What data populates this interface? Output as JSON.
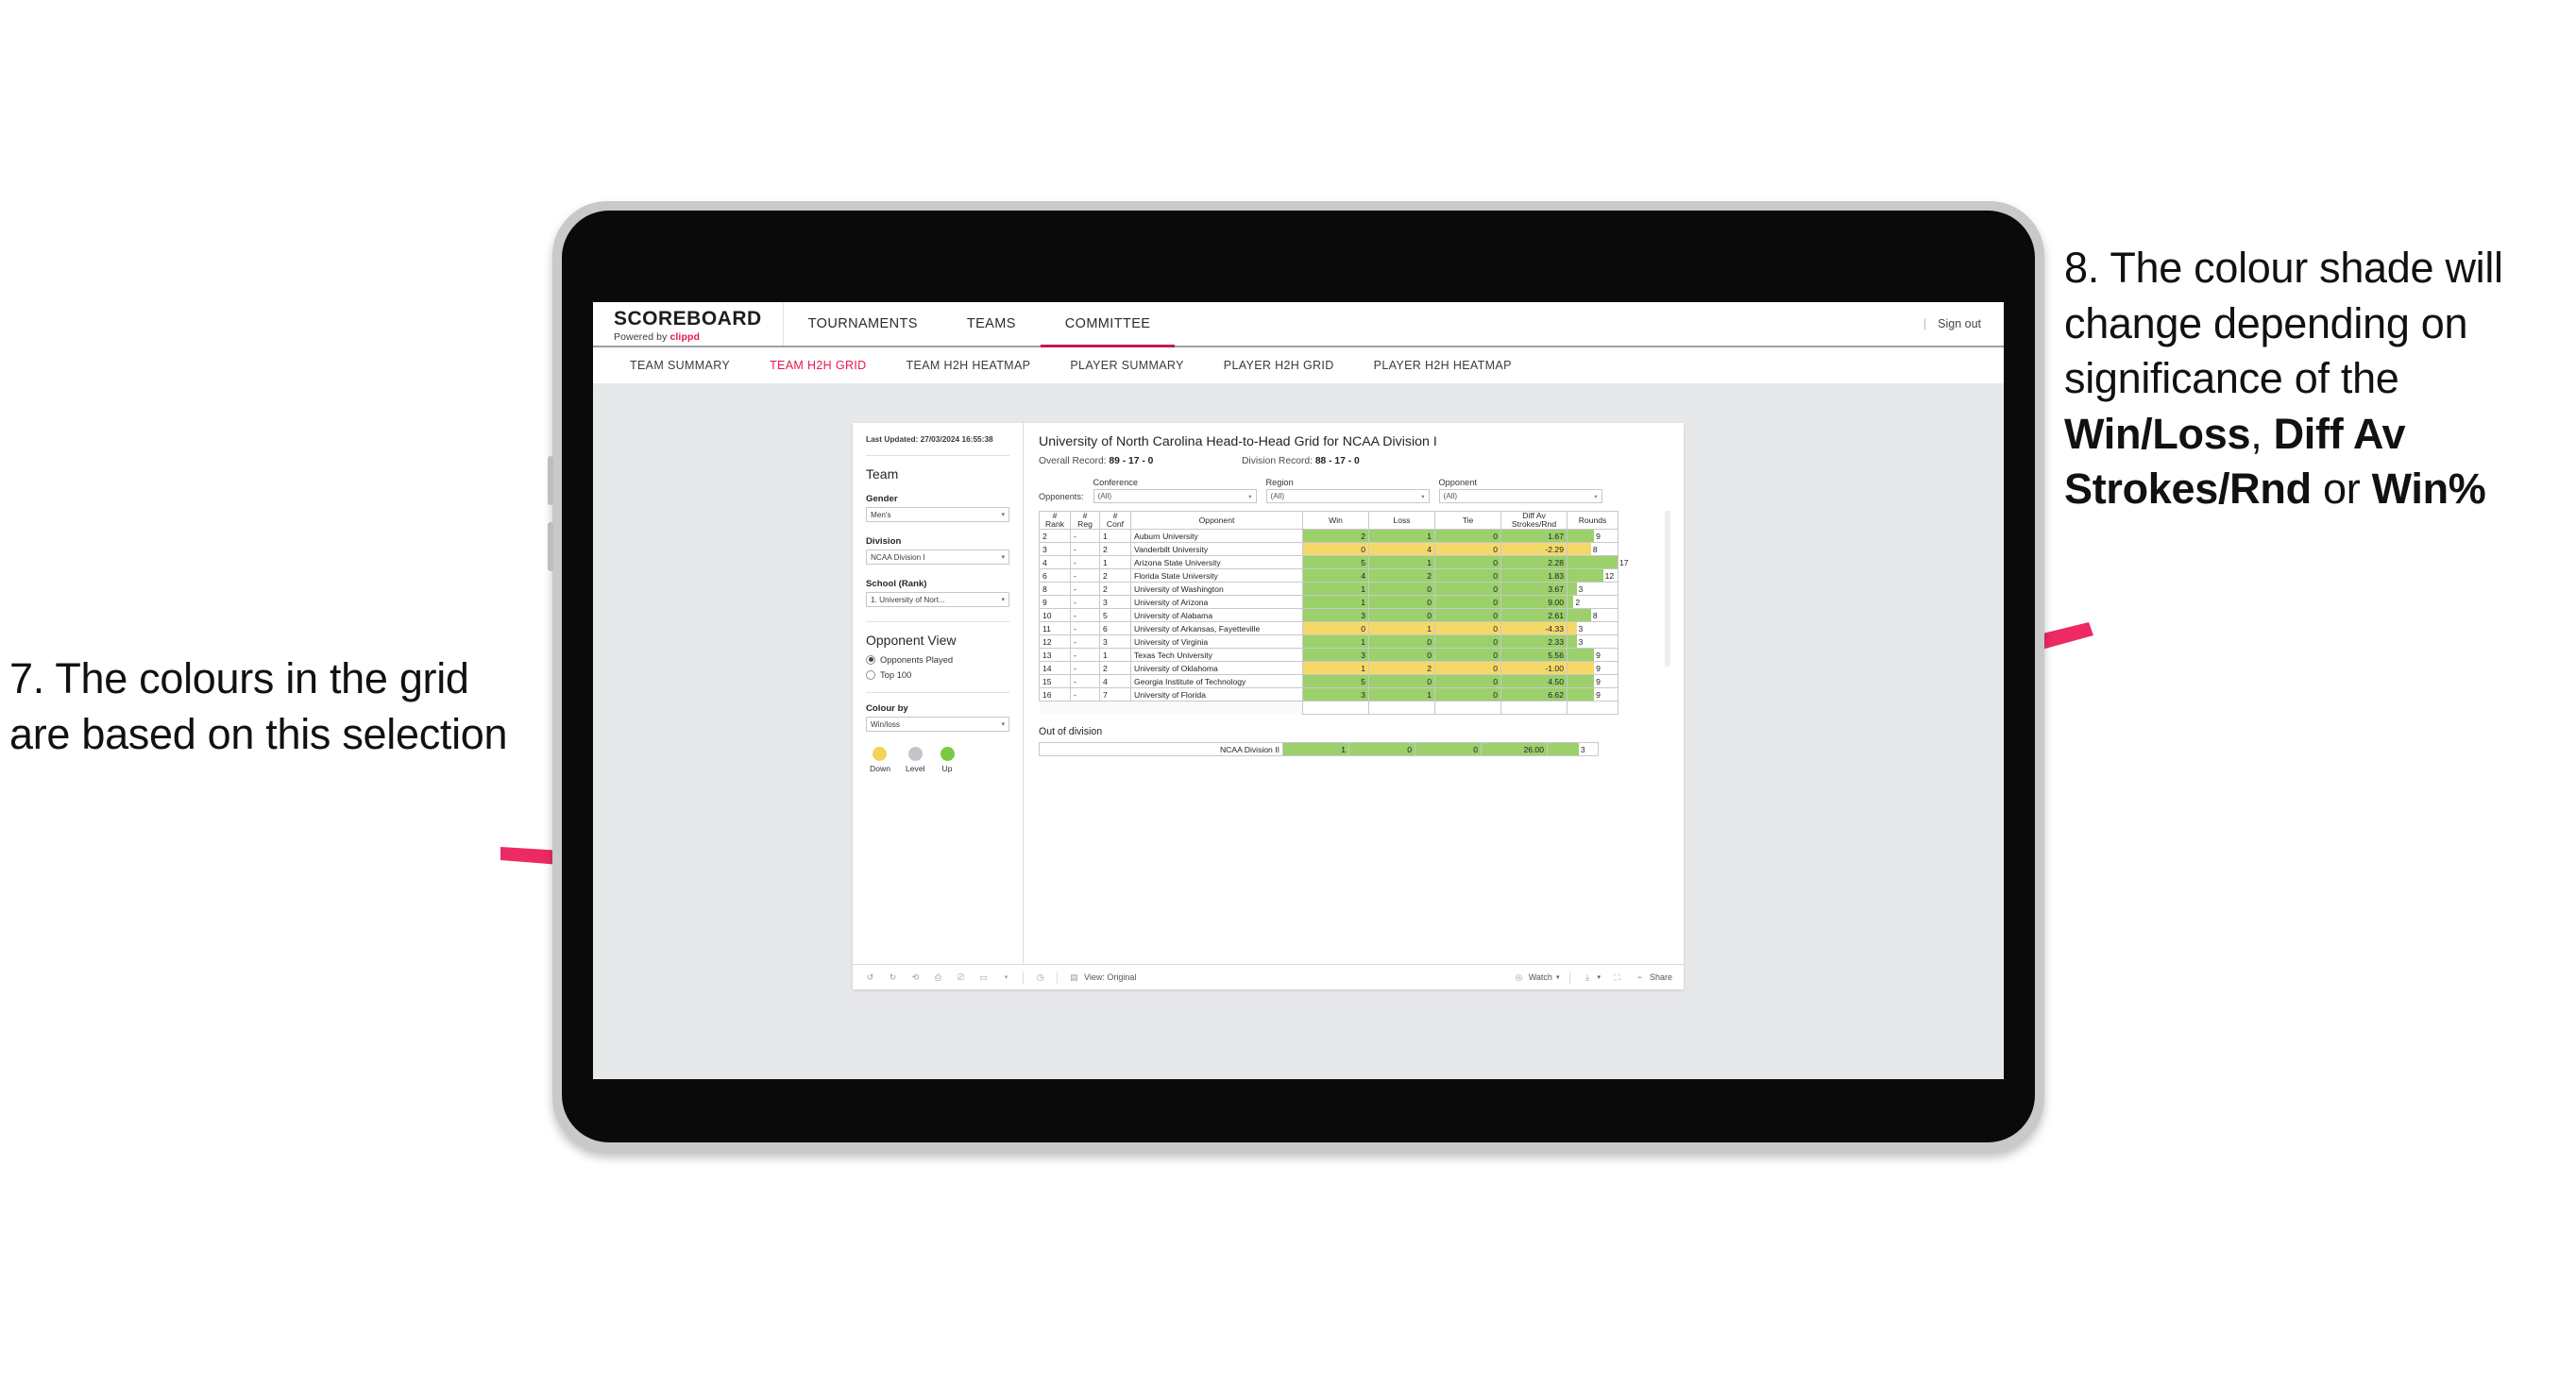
{
  "annotations": {
    "left": {
      "number": "7.",
      "text": "7. The colours in the grid are based on this selection"
    },
    "right": {
      "pre": "8. The colour shade will change depending on significance of the ",
      "bold1": "Win/Loss",
      "mid1": ", ",
      "bold2": "Diff Av Strokes/Rnd",
      "mid2": " or ",
      "bold3": "Win%"
    },
    "arrow_color": "#ED2A63"
  },
  "topnav": {
    "brand_title": "SCOREBOARD",
    "brand_sub_pre": "Powered by ",
    "brand_sub_brand": "clippd",
    "items": [
      {
        "label": "TOURNAMENTS",
        "active": false
      },
      {
        "label": "TEAMS",
        "active": false
      },
      {
        "label": "COMMITTEE",
        "active": true
      }
    ],
    "separator": "|",
    "signout": "Sign out",
    "accent": "#c2185b"
  },
  "subnav": {
    "items": [
      {
        "label": "TEAM SUMMARY",
        "active": false
      },
      {
        "label": "TEAM H2H GRID",
        "active": true
      },
      {
        "label": "TEAM H2H HEATMAP",
        "active": false
      },
      {
        "label": "PLAYER SUMMARY",
        "active": false
      },
      {
        "label": "PLAYER H2H GRID",
        "active": false
      },
      {
        "label": "PLAYER H2H HEATMAP",
        "active": false
      }
    ],
    "active_color": "#e8174e"
  },
  "sidebar": {
    "last_updated_label": "Last Updated: ",
    "last_updated_value": "27/03/2024 16:55:38",
    "team_heading": "Team",
    "gender": {
      "label": "Gender",
      "value": "Men's"
    },
    "division": {
      "label": "Division",
      "value": "NCAA Division I"
    },
    "school": {
      "label": "School (Rank)",
      "value": "1. University of Nort..."
    },
    "opponent_view": {
      "heading": "Opponent View",
      "options": [
        {
          "label": "Opponents Played",
          "selected": true
        },
        {
          "label": "Top 100",
          "selected": false
        }
      ]
    },
    "colour_by": {
      "label": "Colour by",
      "value": "Win/loss"
    },
    "legend": [
      {
        "label": "Down",
        "color": "#f4d457"
      },
      {
        "label": "Level",
        "color": "#c4c4cb"
      },
      {
        "label": "Up",
        "color": "#7ac943"
      }
    ]
  },
  "viz": {
    "title": "University of North Carolina Head-to-Head Grid for NCAA Division I",
    "overall_record_label": "Overall Record: ",
    "overall_record_value": "89 - 17 - 0",
    "division_record_label": "Division Record: ",
    "division_record_value": "88 - 17 - 0",
    "opponents_label": "Opponents:",
    "filters": [
      {
        "title": "Conference",
        "value": "(All)"
      },
      {
        "title": "Region",
        "value": "(All)"
      },
      {
        "title": "Opponent",
        "value": "(All)"
      }
    ],
    "columns": [
      {
        "line1": "#",
        "line2": "Rank"
      },
      {
        "line1": "#",
        "line2": "Reg"
      },
      {
        "line1": "#",
        "line2": "Conf"
      },
      {
        "line1": "Opponent",
        "line2": ""
      },
      {
        "line1": "Win",
        "line2": ""
      },
      {
        "line1": "Loss",
        "line2": ""
      },
      {
        "line1": "Tie",
        "line2": ""
      },
      {
        "line1": "Diff Av",
        "line2": "Strokes/Rnd"
      },
      {
        "line1": "Rounds",
        "line2": ""
      }
    ],
    "rows": [
      {
        "rank": "2",
        "reg": "-",
        "conf": "1",
        "opponent": "Auburn University",
        "win": "2",
        "loss": "1",
        "tie": "0",
        "diff": "1.67",
        "rounds": "9",
        "rounds_pct": 53,
        "state": "up"
      },
      {
        "rank": "3",
        "reg": "-",
        "conf": "2",
        "opponent": "Vanderbilt University",
        "win": "0",
        "loss": "4",
        "tie": "0",
        "diff": "-2.29",
        "rounds": "8",
        "rounds_pct": 47,
        "state": "down"
      },
      {
        "rank": "4",
        "reg": "-",
        "conf": "1",
        "opponent": "Arizona State University",
        "win": "5",
        "loss": "1",
        "tie": "0",
        "diff": "2.28",
        "rounds": "17",
        "rounds_pct": 100,
        "state": "up"
      },
      {
        "rank": "6",
        "reg": "-",
        "conf": "2",
        "opponent": "Florida State University",
        "win": "4",
        "loss": "2",
        "tie": "0",
        "diff": "1.83",
        "rounds": "12",
        "rounds_pct": 71,
        "state": "up"
      },
      {
        "rank": "8",
        "reg": "-",
        "conf": "2",
        "opponent": "University of Washington",
        "win": "1",
        "loss": "0",
        "tie": "0",
        "diff": "3.67",
        "rounds": "3",
        "rounds_pct": 18,
        "state": "up"
      },
      {
        "rank": "9",
        "reg": "-",
        "conf": "3",
        "opponent": "University of Arizona",
        "win": "1",
        "loss": "0",
        "tie": "0",
        "diff": "9.00",
        "rounds": "2",
        "rounds_pct": 12,
        "state": "up"
      },
      {
        "rank": "10",
        "reg": "-",
        "conf": "5",
        "opponent": "University of Alabama",
        "win": "3",
        "loss": "0",
        "tie": "0",
        "diff": "2.61",
        "rounds": "8",
        "rounds_pct": 47,
        "state": "up"
      },
      {
        "rank": "11",
        "reg": "-",
        "conf": "6",
        "opponent": "University of Arkansas, Fayetteville",
        "win": "0",
        "loss": "1",
        "tie": "0",
        "diff": "-4.33",
        "rounds": "3",
        "rounds_pct": 18,
        "state": "down"
      },
      {
        "rank": "12",
        "reg": "-",
        "conf": "3",
        "opponent": "University of Virginia",
        "win": "1",
        "loss": "0",
        "tie": "0",
        "diff": "2.33",
        "rounds": "3",
        "rounds_pct": 18,
        "state": "up"
      },
      {
        "rank": "13",
        "reg": "-",
        "conf": "1",
        "opponent": "Texas Tech University",
        "win": "3",
        "loss": "0",
        "tie": "0",
        "diff": "5.56",
        "rounds": "9",
        "rounds_pct": 53,
        "state": "up"
      },
      {
        "rank": "14",
        "reg": "-",
        "conf": "2",
        "opponent": "University of Oklahoma",
        "win": "1",
        "loss": "2",
        "tie": "0",
        "diff": "-1.00",
        "rounds": "9",
        "rounds_pct": 53,
        "state": "down"
      },
      {
        "rank": "15",
        "reg": "-",
        "conf": "4",
        "opponent": "Georgia Institute of Technology",
        "win": "5",
        "loss": "0",
        "tie": "0",
        "diff": "4.50",
        "rounds": "9",
        "rounds_pct": 53,
        "state": "up"
      },
      {
        "rank": "16",
        "reg": "-",
        "conf": "7",
        "opponent": "University of Florida",
        "win": "3",
        "loss": "1",
        "tie": "0",
        "diff": "6.62",
        "rounds": "9",
        "rounds_pct": 53,
        "state": "up"
      }
    ],
    "out_of_division": {
      "title": "Out of division",
      "row": {
        "label": "NCAA Division II",
        "win": "1",
        "loss": "0",
        "tie": "0",
        "diff": "26.00",
        "rounds": "3",
        "rounds_pct": 62,
        "state": "up"
      }
    },
    "colors": {
      "up": "#9bd06b",
      "down": "#f4d96a"
    }
  },
  "toolbar": {
    "view_label": "View: Original",
    "watch_label": "Watch",
    "share_label": "Share"
  },
  "chart_data": {
    "type": "table",
    "title": "University of North Carolina Head-to-Head Grid for NCAA Division I",
    "categories": [
      "Auburn University",
      "Vanderbilt University",
      "Arizona State University",
      "Florida State University",
      "University of Washington",
      "University of Arizona",
      "University of Alabama",
      "University of Arkansas, Fayetteville",
      "University of Virginia",
      "Texas Tech University",
      "University of Oklahoma",
      "Georgia Institute of Technology",
      "University of Florida",
      "NCAA Division II"
    ],
    "series": [
      {
        "name": "Win",
        "values": [
          2,
          0,
          5,
          4,
          1,
          1,
          3,
          0,
          1,
          3,
          1,
          5,
          3,
          1
        ]
      },
      {
        "name": "Loss",
        "values": [
          1,
          4,
          1,
          2,
          0,
          0,
          0,
          1,
          0,
          0,
          2,
          0,
          1,
          0
        ]
      },
      {
        "name": "Tie",
        "values": [
          0,
          0,
          0,
          0,
          0,
          0,
          0,
          0,
          0,
          0,
          0,
          0,
          0,
          0
        ]
      },
      {
        "name": "Diff Av Strokes/Rnd",
        "values": [
          1.67,
          -2.29,
          2.28,
          1.83,
          3.67,
          9.0,
          2.61,
          -4.33,
          2.33,
          5.56,
          -1.0,
          4.5,
          6.62,
          26.0
        ]
      },
      {
        "name": "Rounds",
        "values": [
          9,
          8,
          17,
          12,
          3,
          2,
          8,
          3,
          3,
          9,
          9,
          9,
          9,
          3
        ]
      }
    ],
    "colour_by": "Win/loss",
    "legend": [
      "Down",
      "Level",
      "Up"
    ],
    "colors": {
      "Down": "#f4d457",
      "Level": "#c4c4cb",
      "Up": "#7ac943"
    }
  }
}
